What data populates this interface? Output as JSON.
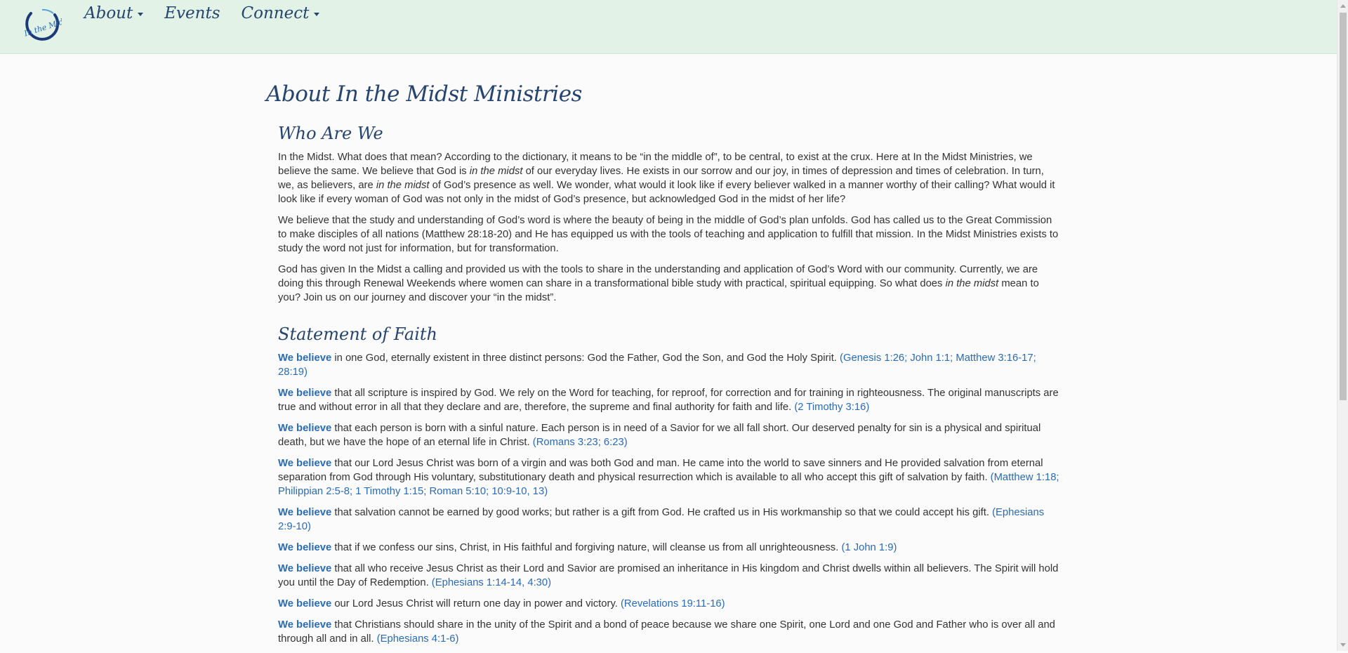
{
  "nav": {
    "logo_text": "In the Midst",
    "items": [
      {
        "label": "About",
        "has_dropdown": true
      },
      {
        "label": "Events",
        "has_dropdown": false
      },
      {
        "label": "Connect",
        "has_dropdown": true
      }
    ]
  },
  "page": {
    "title": "About In the Midst Ministries"
  },
  "who": {
    "title": "Who Are We",
    "p1": {
      "a": "In the Midst. What does that mean? According to the dictionary, it means to be “in the middle of”, to be central, to exist at the crux. Here at In the Midst Ministries, we believe the same. We believe that God is ",
      "b": "in the midst",
      "c": " of our everyday lives. He exists in our sorrow and our joy, in times of depression and times of celebration. In turn, we, as believers, are ",
      "d": "in the midst",
      "e": " of God’s presence as well. We wonder, what would it look like if every believer walked in a manner worthy of their calling? What would it look like if every woman of God was not only in the midst of God’s presence, but acknowledged God in the midst of her life?"
    },
    "p2": "We believe that the study and understanding of God’s word is where the beauty of being in the middle of God’s plan unfolds. God has called us to the Great Commission to make disciples of all nations (Matthew 28:18-20) and He has equipped us with the tools of teaching and application to fulfill that mission. In the Midst Ministries exists to study the word not just for information, but for transformation.",
    "p3": {
      "a": "God has given In the Midst a calling and provided us with the tools to share in the understanding and application of God’s Word with our community. Currently, we are doing this through Renewal Weekends where women can share in a transformational bible study with practical, spiritual equipping. So what does ",
      "b": "in the midst",
      "c": " mean to you? Join us on our journey and discover your “in the midst”."
    }
  },
  "faith": {
    "title": "Statement of Faith",
    "lead": "We believe",
    "items": [
      {
        "text": " in one God, eternally existent in three distinct persons: God the Father, God the Son, and God the Holy Spirit. ",
        "ref": "(Genesis 1:26; John 1:1; Matthew 3:16-17; 28:19)"
      },
      {
        "text": " that all scripture is inspired by God. We rely on the Word for teaching, for reproof, for correction and for training in righteousness. The original manuscripts are true and without error in all that they declare and are, therefore, the supreme and final authority for faith and life. ",
        "ref": "(2 Timothy 3:16)"
      },
      {
        "text": " that each person is born with a sinful nature. Each person is in need of a Savior for we all fall short. Our deserved penalty for sin is a physical and spiritual death, but we have the hope of an eternal life in Christ. ",
        "ref": "(Romans 3:23; 6:23)"
      },
      {
        "text": " that our Lord Jesus Christ was born of a virgin and was both God and man. He came into the world to save sinners and He provided salvation from eternal separation from God through His voluntary, substitutionary death and physical resurrection which is available to all who accept this gift of salvation by faith. ",
        "ref": "(Matthew 1:18; Philippian 2:5-8; 1 Timothy 1:15; Roman 5:10; 10:9-10, 13)"
      },
      {
        "text": " that salvation cannot be earned by good works; but rather is a gift from God. He crafted us in His workmanship so that we could accept his gift. ",
        "ref": "(Ephesians 2:9-10)"
      },
      {
        "text": " that if we confess our sins, Christ, in His faithful and forgiving nature, will cleanse us from all unrighteousness. ",
        "ref": "(1 John 1:9)"
      },
      {
        "text": " that all who receive Jesus Christ as their Lord and Savior are promised an inheritance in His kingdom and Christ dwells within all believers. The Spirit will hold you until the Day of Redemption. ",
        "ref": "(Ephesians 1:14-14, 4:30)"
      },
      {
        "text": " our Lord Jesus Christ will return one day in power and victory. ",
        "ref": "(Revelations 19:11-16)"
      },
      {
        "text": " that Christians should share in the unity of the Spirit and a bond of peace because we share one Spirit, one Lord and one God and Father who is over all and through all and in all. ",
        "ref": "(Ephesians 4:1-6)"
      }
    ]
  },
  "colors": {
    "navbar_bg": "#e2f2e6",
    "heading": "#26456e",
    "link": "#2a6bb5",
    "text": "#333333",
    "page_bg": "#fbfbfb"
  }
}
